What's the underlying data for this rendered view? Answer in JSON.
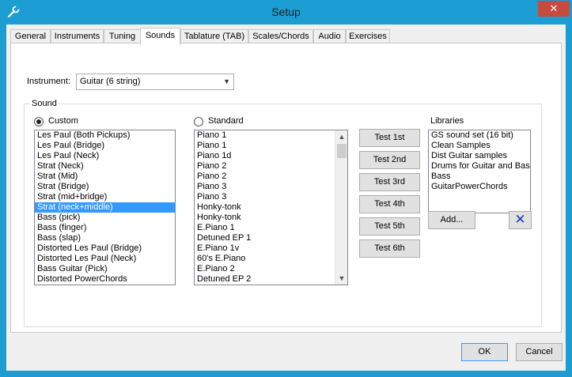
{
  "window": {
    "title": "Setup",
    "close_glyph": "✕",
    "app_icon": "wrench-icon"
  },
  "tabs": [
    {
      "label": "General",
      "active": false
    },
    {
      "label": "Instruments",
      "active": false
    },
    {
      "label": "Tuning",
      "active": false
    },
    {
      "label": "Sounds",
      "active": true
    },
    {
      "label": "Tablature (TAB)",
      "active": false
    },
    {
      "label": "Scales/Chords",
      "active": false
    },
    {
      "label": "Audio",
      "active": false
    },
    {
      "label": "Exercises",
      "active": false
    }
  ],
  "instrument": {
    "label": "Instrument:",
    "value": "Guitar (6 string)"
  },
  "sound": {
    "group_label": "Sound",
    "custom_label": "Custom",
    "standard_label": "Standard",
    "libraries_label": "Libraries",
    "selected_source": "custom"
  },
  "custom_list": [
    "Les Paul (Both Pickups)",
    "Les Paul (Bridge)",
    "Les Paul (Neck)",
    "Strat (Neck)",
    "Strat (Mid)",
    "Strat (Bridge)",
    "Strat (mid+bridge)",
    "Strat (neck+middle)",
    "Bass (pick)",
    "Bass (finger)",
    "Bass (slap)",
    "Distorted Les Paul (Bridge)",
    "Distorted Les Paul (Neck)",
    "Bass Guitar (Pick)",
    "Distorted PowerChords"
  ],
  "custom_selected": "Strat (neck+middle)",
  "standard_list": [
    "Piano 1",
    "Piano 1",
    "Piano 1d",
    "Piano 2",
    "Piano 2",
    "Piano 3",
    "Piano 3",
    "Honky-tonk",
    "Honky-tonk",
    "E.Piano 1",
    "Detuned EP 1",
    "E.Piano 1v",
    "60's E.Piano",
    "E.Piano 2",
    "Detuned EP 2"
  ],
  "test_buttons": [
    "Test 1st",
    "Test 2nd",
    "Test 3rd",
    "Test 4th",
    "Test 5th",
    "Test 6th"
  ],
  "libraries_list": [
    "GS sound set (16 bit)",
    "Clean Samples",
    "Dist Guitar samples",
    "Drums for Guitar and Bass",
    "Bass",
    "GuitarPowerChords"
  ],
  "buttons": {
    "add": "Add...",
    "delete_glyph": "✕",
    "ok": "OK",
    "cancel": "Cancel"
  },
  "colors": {
    "titlebar": "#1c9dd3",
    "selection": "#3399ff",
    "close": "#c74a3f"
  }
}
